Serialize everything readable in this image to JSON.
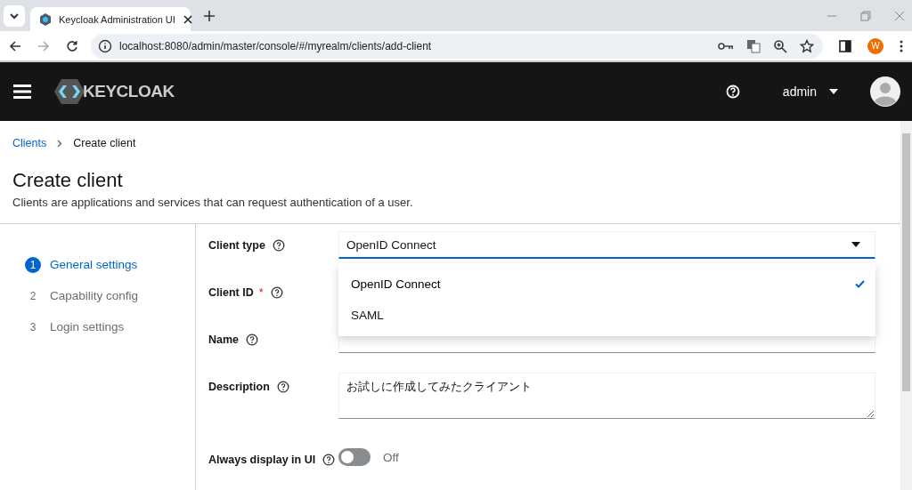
{
  "browser": {
    "tab_title": "Keycloak Administration UI",
    "url": "localhost:8080/admin/master/console/#/myrealm/clients/add-client",
    "profile_initial": "W"
  },
  "header": {
    "logo_text": "KEYCLOAK",
    "user": "admin"
  },
  "breadcrumb": [
    {
      "label": "Clients",
      "link": true
    },
    {
      "label": "Create client",
      "link": false
    }
  ],
  "page": {
    "title": "Create client",
    "subtitle": "Clients are applications and services that can request authentication of a user."
  },
  "steps": [
    {
      "number": "1",
      "label": "General settings",
      "selected": true
    },
    {
      "number": "2",
      "label": "Capability config",
      "selected": false
    },
    {
      "number": "3",
      "label": "Login settings",
      "selected": false
    }
  ],
  "form": [
    {
      "kind": "select",
      "label": "Client type",
      "value": "OpenID Connect",
      "expanded": true,
      "options": [
        {
          "label": "OpenID Connect",
          "selected": true
        },
        {
          "label": "SAML",
          "selected": false
        }
      ]
    },
    {
      "kind": "label",
      "label": "Client ID",
      "required_mark": "*"
    },
    {
      "kind": "text",
      "label": "Name"
    },
    {
      "kind": "textarea",
      "label": "Description",
      "value": "お試しに作成してみたクライアント"
    },
    {
      "kind": "switch",
      "label": "Always display in UI",
      "on": false,
      "state_label": "Off"
    }
  ]
}
